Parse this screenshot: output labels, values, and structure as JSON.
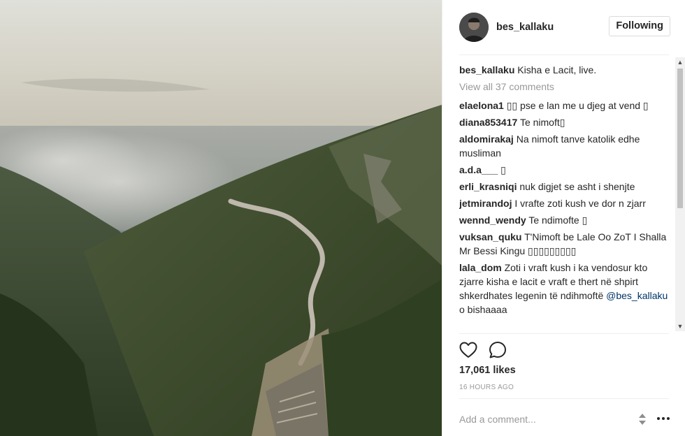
{
  "post": {
    "image_alt": "Mountain valley with winding road and smoke haze",
    "author": "bes_kallaku",
    "follow_label": "Following",
    "caption": "Kisha e Lacit, live.",
    "view_all": "View all 37 comments",
    "likes": "17,061 likes",
    "time": "16 HOURS AGO",
    "add_comment_placeholder": "Add a comment..."
  },
  "comments": [
    {
      "user": "elaelona1",
      "text": "▯▯ pse e lan me u djeg at vend ▯"
    },
    {
      "user": "diana853417",
      "text": "Te nimoft▯"
    },
    {
      "user": "aldomirakaj",
      "text": "Na nimoft tanve katolik edhe musliman"
    },
    {
      "user": "a.d.a___",
      "text": "▯"
    },
    {
      "user": "erli_krasniqi",
      "text": "nuk digjet se asht i shenjte"
    },
    {
      "user": "jetmirandoj",
      "text": "I vrafte zoti kush ve dor n zjarr"
    },
    {
      "user": "wennd_wendy",
      "text": "Te ndimofte ▯"
    },
    {
      "user": "vuksan_quku",
      "text": "T'Nimoft be Lale Oo ZoT I Shalla Mr Bessi Kingu ▯▯▯▯▯▯▯▯▯"
    },
    {
      "user": "lala_dom",
      "text": "Zoti i vraft kush i ka vendosur kto zjarre kisha e lacit e vraft e thert në shpirt shkerdhates legenin të ndihmoftë",
      "mention": "@bes_kallaku",
      "tail": "o bishaaaa"
    }
  ],
  "scrollbar": {
    "up": "▲",
    "down": "▼"
  },
  "icons": {
    "like": "heart-icon",
    "comment": "comment-bubble-icon",
    "resize": "resize-handle-icon",
    "more": "more-options-icon"
  },
  "colors": {
    "text": "#262626",
    "muted": "#999999",
    "border": "#dbdbdb",
    "mention": "#003569"
  }
}
